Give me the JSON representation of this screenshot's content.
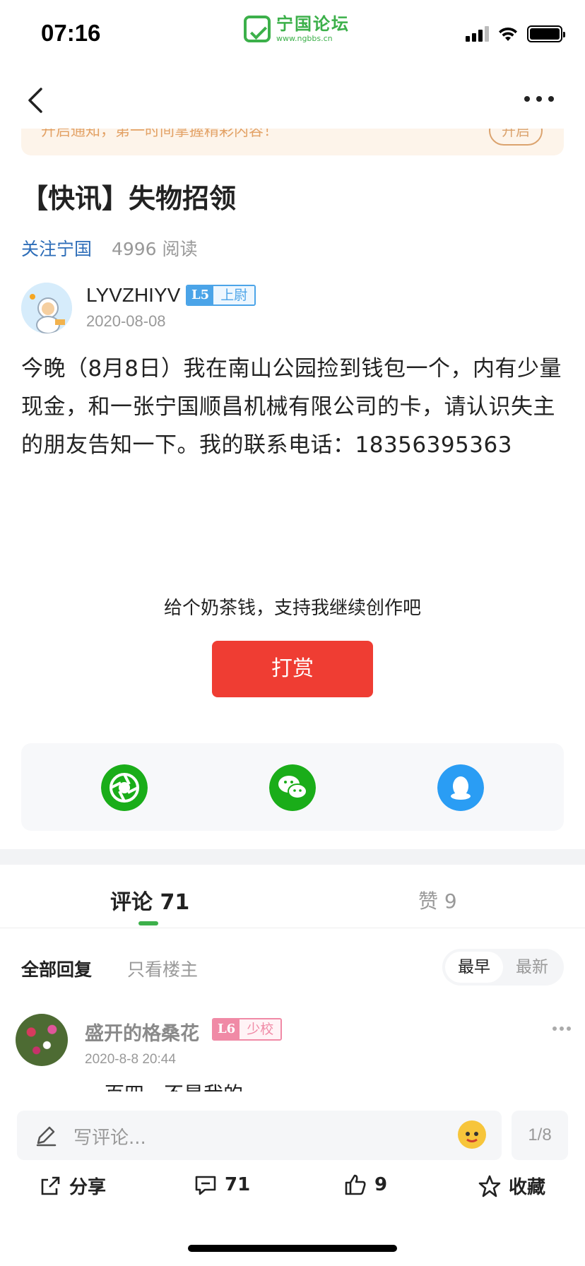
{
  "status_bar": {
    "time": "07:16"
  },
  "logo": {
    "name": "宁国论坛",
    "url": "www.ngbbs.cn"
  },
  "notice": {
    "text": "开启通知，第一时间掌握精彩内容！",
    "button": "开启"
  },
  "post": {
    "title": "【快讯】失物招领",
    "follow_label": "关注宁国",
    "reads": "4996 阅读",
    "author": {
      "name": "LYVZHIYV",
      "level": "L5",
      "rank": "上尉",
      "date": "2020-08-08"
    },
    "content": "今晚（8月8日）我在南山公园捡到钱包一个，内有少量现金，和一张宁国顺昌机械有限公司的卡，请认识失主的朋友告知一下。我的联系电话：18356395363"
  },
  "tip": {
    "text": "给个奶茶钱，支持我继续创作吧",
    "button": "打赏"
  },
  "share_icons": [
    "moments-icon",
    "wechat-icon",
    "qq-icon"
  ],
  "tabs": {
    "comments": "评论 71",
    "likes": "赞 9"
  },
  "filters": {
    "all": "全部回复",
    "host_only": "只看楼主",
    "sort_earliest": "最早",
    "sort_latest": "最新"
  },
  "comment": {
    "name": "盛开的格桑花",
    "level": "L6",
    "rank": "少校",
    "date": "2020-8-8 20:44",
    "text": "一百四，不是我的"
  },
  "input": {
    "placeholder": "写评论...",
    "page": "1/8"
  },
  "actions": {
    "share": "分享",
    "comments": "71",
    "likes": "9",
    "favorite": "收藏"
  },
  "colors": {
    "brand_green": "#3cb04a",
    "tip_red": "#ef3d33",
    "link_blue": "#2d6db8"
  }
}
